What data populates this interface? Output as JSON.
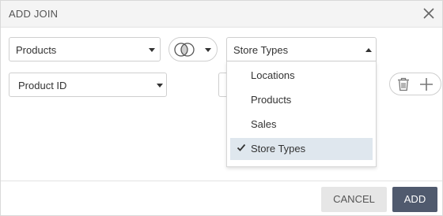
{
  "dialog": {
    "title": "ADD JOIN",
    "cancel_label": "CANCEL",
    "add_label": "ADD"
  },
  "join": {
    "left_table": "Products",
    "right_table": "Store Types",
    "left_field": "Product ID"
  },
  "dropdown": {
    "options": [
      "Locations",
      "Products",
      "Sales",
      "Store Types"
    ],
    "selected": "Store Types"
  },
  "colors": {
    "primary_button": "#505a6e",
    "selected_option": "#dfe7ee"
  }
}
